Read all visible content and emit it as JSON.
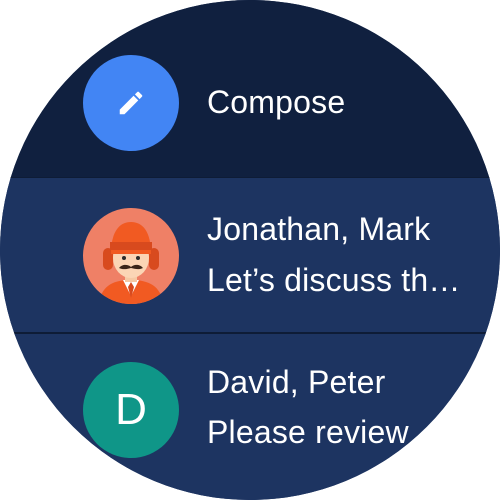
{
  "compose": {
    "label": "Compose",
    "icon": "pencil-icon",
    "color": "#4285f4"
  },
  "messages": [
    {
      "sender": "Jonathan, Mark",
      "preview": "Let’s discuss th…",
      "avatar_type": "photo",
      "avatar_color": "#ef8066"
    },
    {
      "sender": "David, Peter",
      "preview": "Please review",
      "avatar_type": "letter",
      "avatar_letter": "D",
      "avatar_color": "#0f9688"
    }
  ],
  "theme": {
    "compose_background": "#10203f",
    "list_background": "#1d3461",
    "divider": "#0e1c36"
  }
}
